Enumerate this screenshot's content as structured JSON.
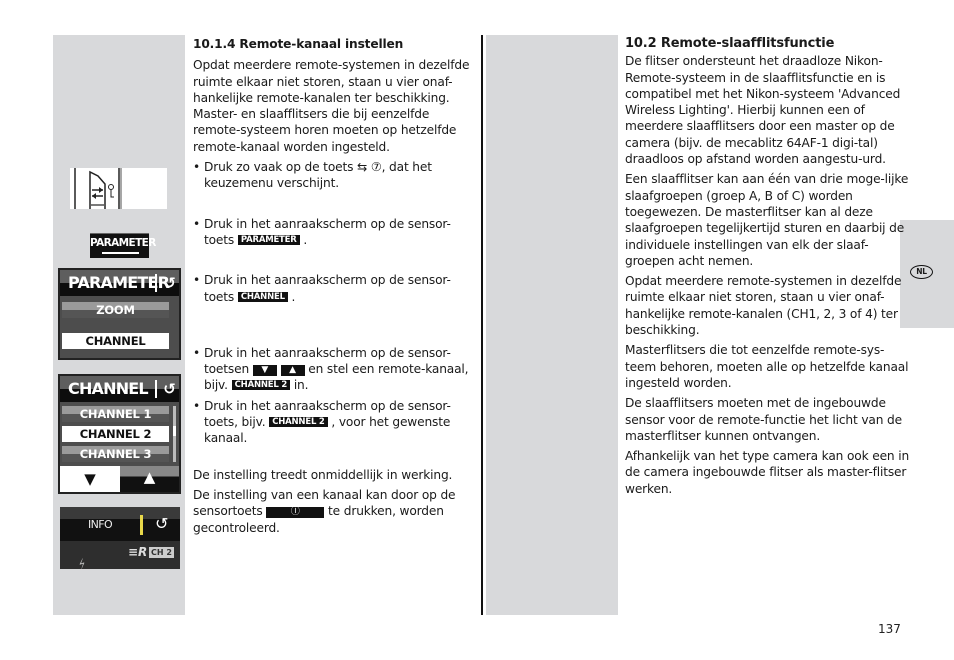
{
  "left_column": {
    "heading": "10.1.4 Remote-kanaal instellen",
    "intro": "Opdat meerdere remote-systemen in dezelfde ruimte elkaar niet storen, staan u vier onaf-hankelijke remote-kanalen ter beschikking. Master- en slaafflitsers die bij eenzelfde remote-systeem horen moeten op hetzelfde remote-kanaal worden ingesteld.",
    "step1": {
      "before": "Druk zo vaak op de toets ",
      "symbol": "⇆ ⑦",
      "after": ", dat het keuzemenu verschijnt."
    },
    "step2": {
      "before": "Druk in het  aanraakscherm op de sensor-toets ",
      "chip": "PARAMETER",
      "after": " ."
    },
    "step3": {
      "before": "Druk in het  aanraakscherm op de sensor-toets ",
      "chip": "CHANNEL",
      "after": " ."
    },
    "step4": {
      "before": "Druk in het aanraakscherm op de sensor-toetsen ",
      "down": "▼",
      "up": "▲",
      "middle": " en stel een remote-kanaal, bijv. ",
      "chip": "CHANNEL 2",
      "after": " in."
    },
    "step5": {
      "before": "Druk in het aanraakscherm op de sensor-toets, bijv. ",
      "chip": "CHANNEL 2",
      "after": " , voor het gewenste kanaal."
    },
    "effect": "De instelling treedt onmiddellijk in werking.",
    "check": {
      "before": "De instelling van een kanaal kan door op de sensortoets ",
      "chip": "Ⓘ",
      "after": " te drukken, worden gecontroleerd."
    }
  },
  "illustrations": {
    "switch_icon": "mode-switch-key-icon",
    "parameter_chip": "PARAMETER",
    "parameter_screen": {
      "title": "PARAMETER",
      "back": "↺",
      "items": [
        {
          "label": "ZOOM",
          "selected": false
        },
        {
          "label": "CHANNEL",
          "selected": true
        }
      ]
    },
    "channel_screen": {
      "title": "CHANNEL",
      "back": "↺",
      "items": [
        {
          "label": "CHANNEL 1",
          "selected": false
        },
        {
          "label": "CHANNEL 2",
          "selected": true
        },
        {
          "label": "CHANNEL 3",
          "selected": false
        }
      ],
      "down": "▼",
      "up": "▲"
    },
    "info_screen": {
      "info": "INFO",
      "back": "↺",
      "remote_indicator": "≡R",
      "channel_badge": "CH 2",
      "flash": "⚡"
    }
  },
  "right_column": {
    "heading": "10.2 Remote-slaafflitsfunctie",
    "paragraphs": [
      "De flitser ondersteunt het draadloze Nikon-Remote-systeem in de slaafflitsfunctie en is compatibel met het Nikon-systeem 'Advanced Wireless Lighting'. Hierbij kunnen een of meerdere slaafflitsers door een master op de camera (bijv. de mecablitz 64AF-1 digi-tal) draadloos op afstand worden aangestu-urd.",
      "Een slaafflitser kan aan één van drie moge-lijke slaafgroepen (groep A, B of C) worden toegewezen. De masterflitser kan al deze slaafgroepen tegelijkertijd sturen en daarbij de individuele instellingen van elk der slaaf-groepen acht nemen.",
      "Opdat meerdere remote-systemen in dezelfde ruimte elkaar niet storen, staan u vier onaf-hankelijke remote-kanalen (CH1, 2, 3 of 4) ter beschikking.",
      "Masterflitsers die tot eenzelfde remote-sys-teem behoren, moeten alle op hetzelfde kanaal ingesteld worden.",
      "De slaafflitsers moeten met de ingebouwde sensor voor de remote-functie het licht van de masterflitser kunnen ontvangen.",
      "Afhankelijk van het type camera kan ook een in de camera ingebouwde flitser als master-flitser werken."
    ]
  },
  "language_tab": "NL",
  "page_number": "137"
}
